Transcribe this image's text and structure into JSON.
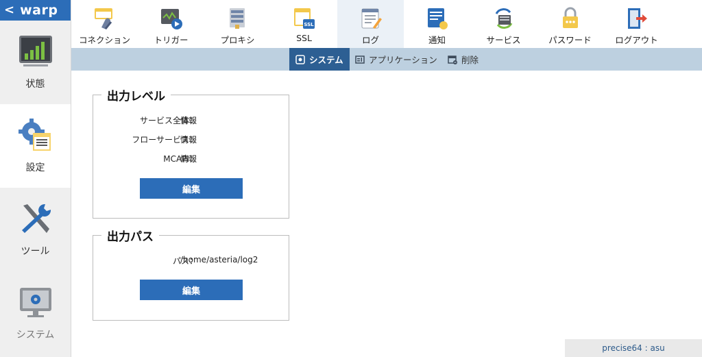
{
  "brand": {
    "back_icon": "chevron-left-icon",
    "name": "warp"
  },
  "sidebar": {
    "items": [
      {
        "label": "状態",
        "icon": "status-chart-icon"
      },
      {
        "label": "設定",
        "icon": "settings-gear-icon"
      },
      {
        "label": "ツール",
        "icon": "tools-icon"
      },
      {
        "label": "システム",
        "icon": "system-monitor-icon"
      }
    ]
  },
  "topnav": {
    "tabs": [
      {
        "label": "コネクション",
        "icon": "connection-icon"
      },
      {
        "label": "トリガー",
        "icon": "trigger-icon"
      },
      {
        "label": "プロキシ",
        "icon": "proxy-icon"
      },
      {
        "label": "SSL",
        "icon": "ssl-icon"
      },
      {
        "label": "ログ",
        "icon": "log-icon"
      },
      {
        "label": "通知",
        "icon": "notification-icon"
      },
      {
        "label": "サービス",
        "icon": "service-icon"
      },
      {
        "label": "パスワード",
        "icon": "password-lock-icon"
      },
      {
        "label": "ログアウト",
        "icon": "logout-icon"
      }
    ]
  },
  "subnav": {
    "tabs": [
      {
        "label": "システム",
        "icon": "system-log-icon"
      },
      {
        "label": "アプリケーション",
        "icon": "application-log-icon"
      },
      {
        "label": "削除",
        "icon": "delete-calendar-icon"
      }
    ]
  },
  "output_level": {
    "title": "出力レベル",
    "rows": [
      {
        "key": "サービス全体",
        "sep": "：",
        "value": "情報"
      },
      {
        "key": "フローサービス",
        "sep": "：",
        "value": "情報"
      },
      {
        "key": "MCAPI",
        "sep": "：",
        "value": "情報"
      }
    ],
    "edit_label": "編集"
  },
  "output_path": {
    "title": "出力パス",
    "rows": [
      {
        "key": "パス",
        "sep": "：",
        "value": "/home/asteria/log2"
      }
    ],
    "edit_label": "編集"
  },
  "footer": {
    "text": "precise64 : asu"
  },
  "colors": {
    "accent": "#2c6db8",
    "subnav_bg": "#bdd0e0",
    "subnav_active": "#2d5f93",
    "tab_active_bg": "#ebf1f7",
    "sidebar_bg": "#efefef"
  }
}
